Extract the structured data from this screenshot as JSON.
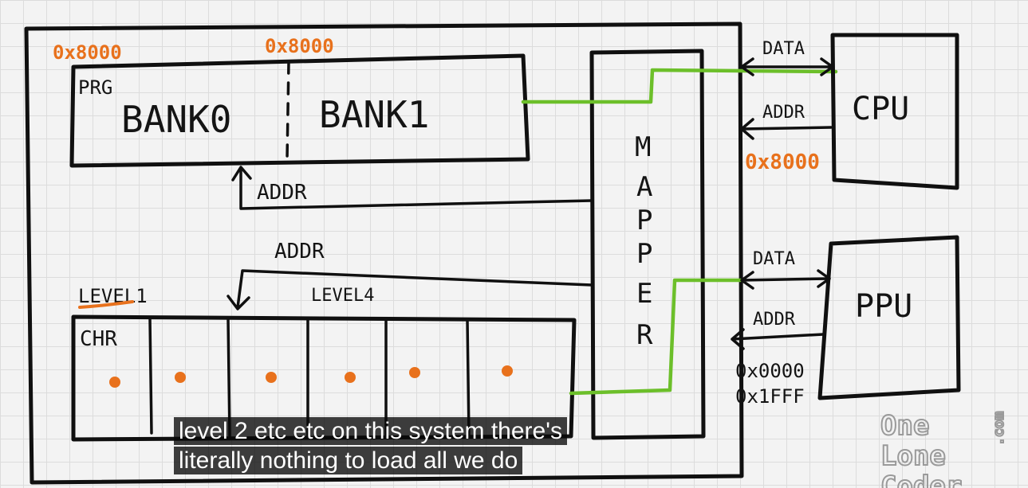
{
  "diagram": {
    "prg_label": "PRG",
    "bank0_label": "BANK0",
    "bank1_label": "BANK1",
    "bank0_addr": "0x8000",
    "bank1_addr": "0x8000",
    "prg_addr_label": "ADDR",
    "chr_addr_label": "ADDR",
    "level1_label": "LEVEL1",
    "level4_label": "LEVEL4",
    "chr_label": "CHR",
    "mapper_label": [
      "M",
      "A",
      "P",
      "P",
      "E",
      "R"
    ],
    "cpu_label": "CPU",
    "cpu_data_label": "DATA",
    "cpu_addr_label": "ADDR",
    "cpu_addr_value": "0x8000",
    "ppu_label": "PPU",
    "ppu_data_label": "DATA",
    "ppu_addr_label": "ADDR",
    "ppu_range_start": "0x0000",
    "ppu_range_end": "0x1FFF",
    "colors": {
      "ink": "#101010",
      "orange": "#e8711c",
      "green": "#6cbf2a"
    }
  },
  "logo": {
    "line1": "One",
    "line2": "Lone",
    "line3": "Coder",
    "suffix": ".com"
  },
  "caption": {
    "line1": "level 2 etc etc on this system there's",
    "line2": "literally nothing to load all we do"
  }
}
